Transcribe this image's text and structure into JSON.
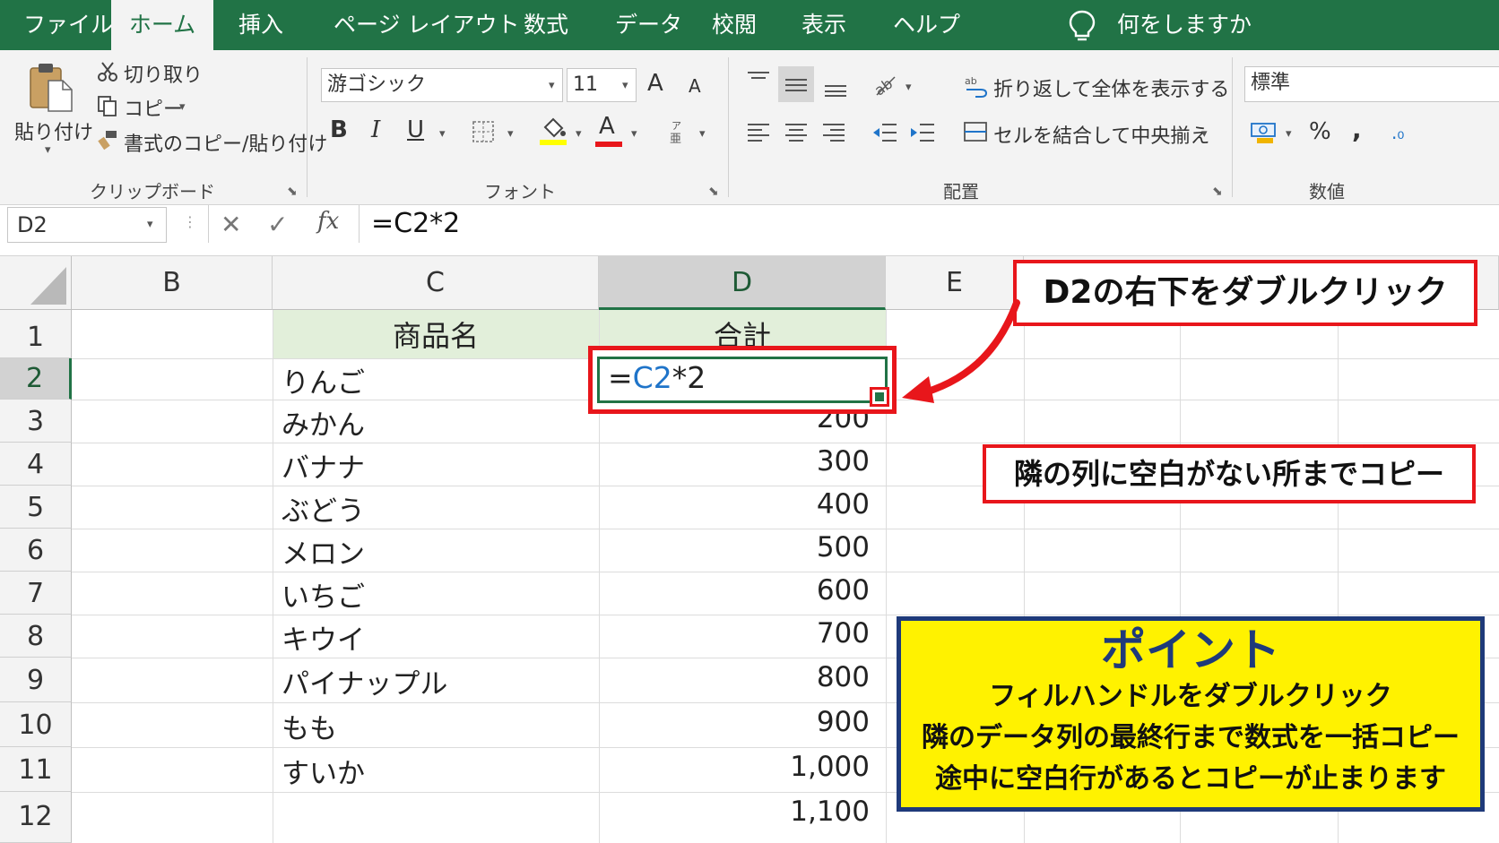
{
  "ribbon_tabs": [
    "ファイル",
    "ホーム",
    "挿入",
    "ページ レイアウト",
    "数式",
    "データ",
    "校閲",
    "表示",
    "ヘルプ"
  ],
  "tell_me": "何をしますか",
  "clipboard": {
    "paste": "貼り付け",
    "cut": "切り取り",
    "copy": "コピー",
    "format_painter": "書式のコピー/貼り付け",
    "group_label": "クリップボード"
  },
  "font": {
    "name": "游ゴシック",
    "size": "11",
    "grow": "A",
    "shrink": "A",
    "bold": "B",
    "italic": "I",
    "underline": "U",
    "color_letter": "A",
    "group_label": "フォント"
  },
  "alignment": {
    "wrap_text": "折り返して全体を表示する",
    "merge_center": "セルを結合して中央揃え",
    "group_label": "配置"
  },
  "number": {
    "format": "標準",
    "percent": "%",
    "comma": ",",
    "group_label": "数値"
  },
  "formula_bar": {
    "name_box": "D2",
    "fx": "fx",
    "formula": "=C2*2"
  },
  "sheet": {
    "columns": [
      "B",
      "C",
      "D",
      "E"
    ],
    "rows": [
      "1",
      "2",
      "3",
      "4",
      "5",
      "6",
      "7",
      "8",
      "9",
      "10",
      "11",
      "12"
    ],
    "header_c": "商品名",
    "header_d": "合計",
    "products": [
      "りんご",
      "みかん",
      "バナナ",
      "ぶどう",
      "メロン",
      "いちご",
      "キウイ",
      "パイナップル",
      "もも",
      "すいか",
      ""
    ],
    "totals": [
      "",
      "200",
      "300",
      "400",
      "500",
      "600",
      "700",
      "800",
      "900",
      "1,000",
      "1,100"
    ],
    "active_cell": {
      "eq": "=",
      "ref": "C2",
      "rest": "*2"
    }
  },
  "callouts": {
    "double_click": "D2の右下をダブルクリック",
    "copy_until_blank": "隣の列に空白がない所までコピー",
    "point_title": "ポイント",
    "point_lines": [
      "フィルハンドルをダブルクリック",
      "隣のデータ列の最終行まで数式を一括コピー",
      "途中に空白行があるとコピーが止まります"
    ]
  },
  "colors": {
    "excel_green": "#217346",
    "highlight_red": "#e8161b",
    "point_yellow": "#fff200",
    "point_border": "#1f3a7a",
    "ref_blue": "#1f74c9",
    "header_fill": "#e2efda"
  }
}
